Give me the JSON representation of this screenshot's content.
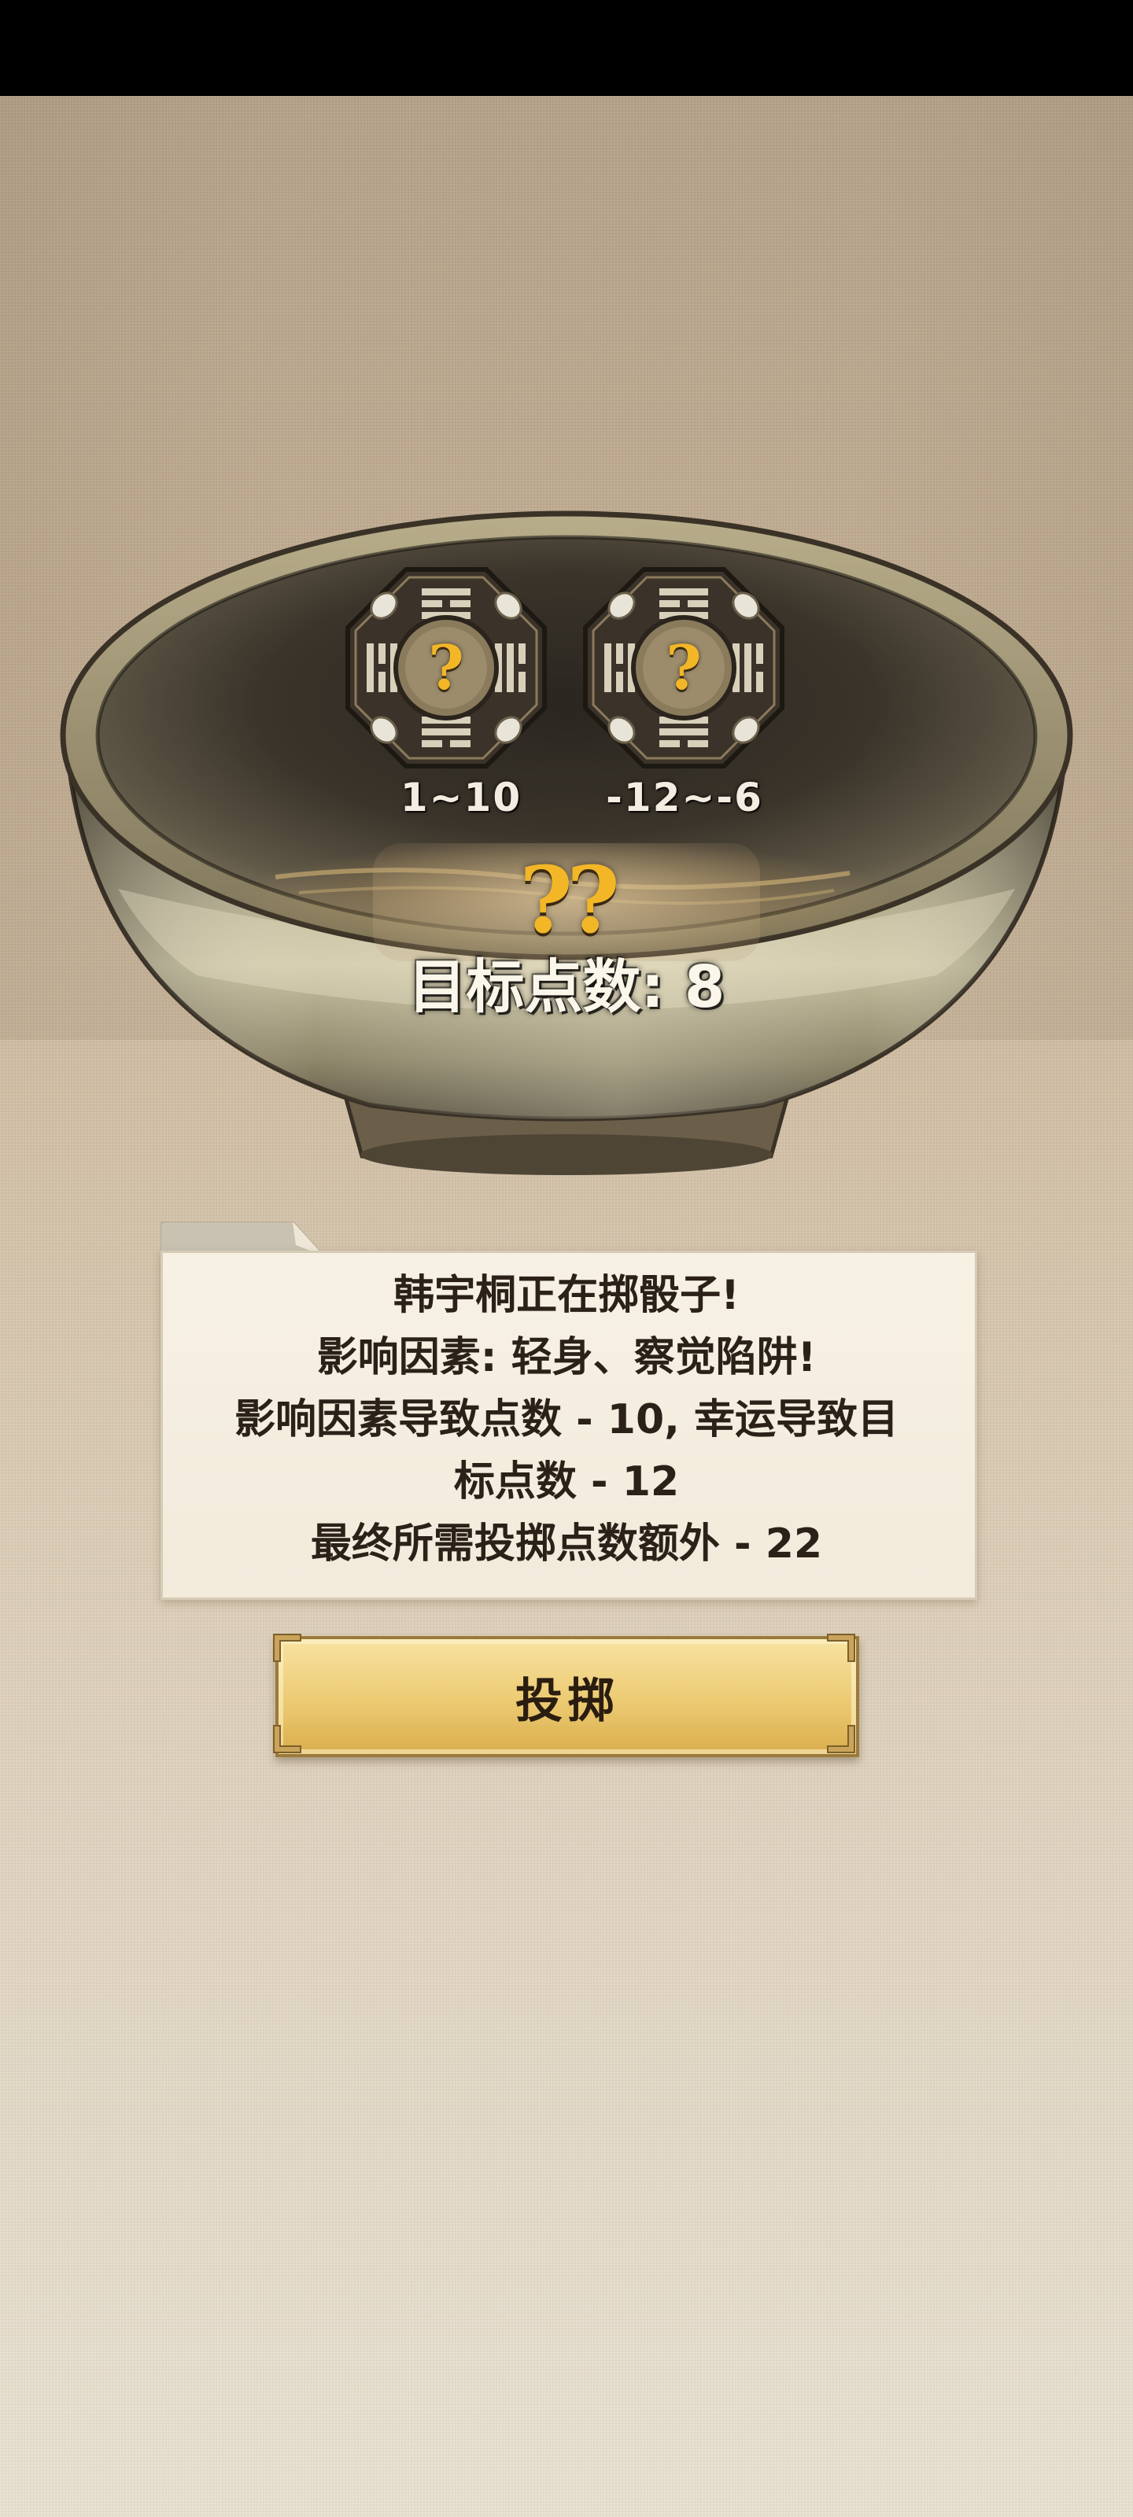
{
  "dice": [
    {
      "face": "?",
      "range": "1~10"
    },
    {
      "face": "?",
      "range": "-12~-6"
    }
  ],
  "result": "??",
  "target": {
    "text": "目标点数: 8"
  },
  "message": {
    "lines": [
      "韩宇桐正在掷骰子!",
      "影响因素: 轻身、察觉陷阱!",
      "影响因素导致点数 - 10, 幸运导致目",
      "标点数 - 12",
      "最终所需投掷点数额外 - 22"
    ]
  },
  "roll_button": {
    "label": "投掷"
  },
  "colors": {
    "accent_gold": "#f2b627",
    "bowl_rim": "#8a7c60",
    "panel_bg": "#f7f1e4",
    "button_gold": "#ecca72",
    "text_dark": "#2b2118"
  }
}
